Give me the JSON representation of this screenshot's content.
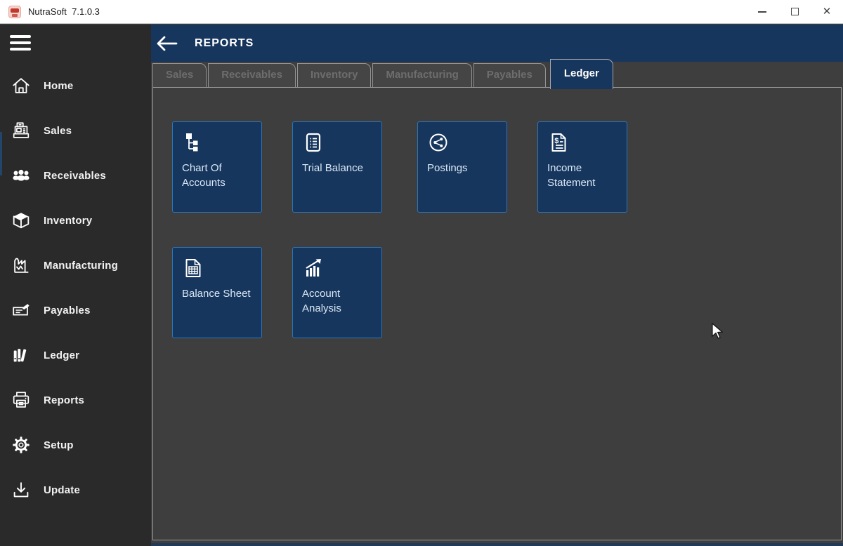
{
  "window": {
    "title": "NutraSoft  7.1.0.3",
    "icons": [
      "app-logo-icon",
      "minimize-icon",
      "maximize-icon",
      "close-icon"
    ]
  },
  "sidebar": {
    "menu_icon": "hamburger-icon",
    "items": [
      {
        "label": "Home",
        "icon": "home-icon"
      },
      {
        "label": "Sales",
        "icon": "cash-register-icon"
      },
      {
        "label": "Receivables",
        "icon": "people-icon"
      },
      {
        "label": "Inventory",
        "icon": "cube-icon"
      },
      {
        "label": "Manufacturing",
        "icon": "factory-icon"
      },
      {
        "label": "Payables",
        "icon": "cheque-pen-icon"
      },
      {
        "label": "Ledger",
        "icon": "books-icon"
      },
      {
        "label": "Reports",
        "icon": "printer-icon"
      },
      {
        "label": "Setup",
        "icon": "gear-icon"
      },
      {
        "label": "Update",
        "icon": "download-icon"
      }
    ]
  },
  "header": {
    "title": "REPORTS",
    "back_icon": "back-arrow-icon"
  },
  "tabs": [
    {
      "label": "Sales",
      "active": false
    },
    {
      "label": "Receivables",
      "active": false
    },
    {
      "label": "Inventory",
      "active": false
    },
    {
      "label": "Manufacturing",
      "active": false
    },
    {
      "label": "Payables",
      "active": false
    },
    {
      "label": "Ledger",
      "active": true
    }
  ],
  "tiles": [
    {
      "label": "Chart Of Accounts",
      "icon": "hierarchy-icon"
    },
    {
      "label": "Trial Balance",
      "icon": "list-document-icon"
    },
    {
      "label": "Postings",
      "icon": "share-circle-icon"
    },
    {
      "label": "Income Statement",
      "icon": "dollar-document-icon"
    },
    {
      "label": "Balance Sheet",
      "icon": "table-document-icon"
    },
    {
      "label": "Account Analysis",
      "icon": "bar-chart-arrow-icon"
    }
  ],
  "colors": {
    "accent_navy": "#17365d",
    "tile_border": "#2e75b6",
    "tile_text": "#dae8f6",
    "sidebar_bg": "#2a2a2a",
    "content_bg": "#3e3e3e",
    "inactive_tab_bg": "#454545",
    "inactive_tab_text": "#6d6d6d"
  }
}
